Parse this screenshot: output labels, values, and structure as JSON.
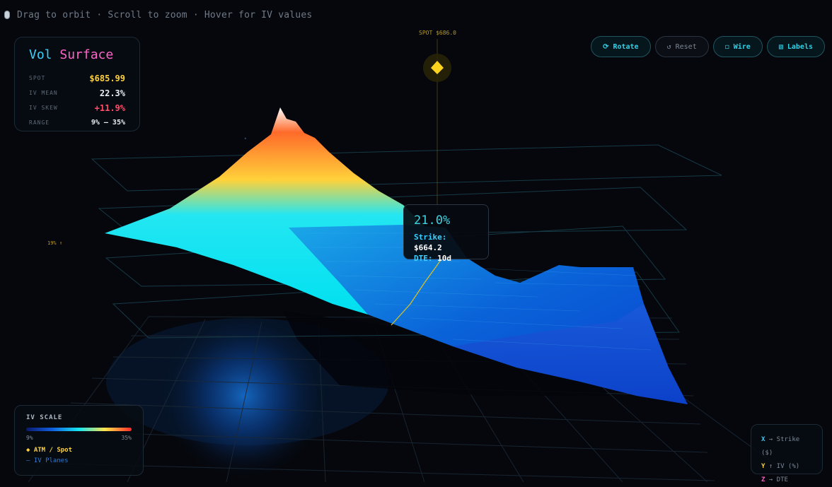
{
  "topbar": {
    "hint": "Drag to orbit · Scroll to zoom · Hover for IV values"
  },
  "spot_marker": {
    "label": "SPOT $686.0"
  },
  "side_label": {
    "text": "19% ↑"
  },
  "stats": {
    "title_part1": "Vol",
    "title_part2": "Surface",
    "rows": [
      {
        "label": "SPOT",
        "value": "$685.99"
      },
      {
        "label": "IV MEAN",
        "value": "22.3%"
      },
      {
        "label": "IV SKEW",
        "value": "+11.9%"
      },
      {
        "label": "RANGE",
        "value": "9% — 35%"
      }
    ]
  },
  "controls": {
    "rotate": {
      "icon": "⟳",
      "label": "Rotate"
    },
    "reset": {
      "icon": "↺",
      "label": "Reset"
    },
    "wire": {
      "icon": "◻",
      "label": "Wire"
    },
    "labels": {
      "icon": "▧",
      "label": "Labels"
    }
  },
  "tooltip": {
    "iv": "21.0%",
    "strike_label": "Strike:",
    "strike_value": "$664.2",
    "dte_label": "DTE:",
    "dte_value": "10d"
  },
  "iv_scale": {
    "title": "IV SCALE",
    "min": "9%",
    "max": "35%",
    "legend_atm": "◆ ATM / Spot",
    "legend_planes": "— IV Planes",
    "colors": [
      "#0b1a6e",
      "#0f5fe0",
      "#16e6f0",
      "#ffe34a",
      "#ff2a2a"
    ]
  },
  "axes_legend": {
    "x": {
      "key": "X",
      "text": "→ Strike ($)"
    },
    "y": {
      "key": "Y",
      "text": "↑ IV (%)"
    },
    "z": {
      "key": "Z",
      "text": "→ DTE"
    }
  },
  "colors": {
    "accent": "#39d0ff",
    "spot": "#ffd23a",
    "skew": "#ff4d6a",
    "background": "#05070c"
  }
}
